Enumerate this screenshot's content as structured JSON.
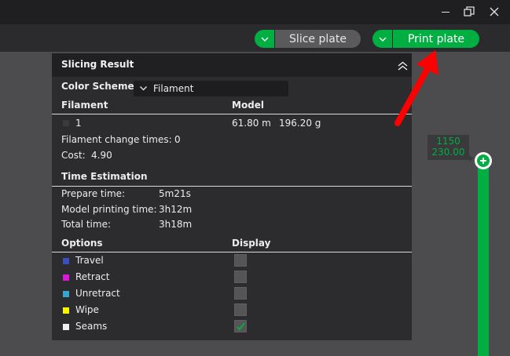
{
  "toolbar": {
    "slice_label": "Slice plate",
    "print_label": "Print plate"
  },
  "panel": {
    "title": "Slicing Result",
    "color_scheme_label": "Color Scheme",
    "color_scheme_value": "Filament",
    "filament_header": "Filament",
    "model_header": "Model",
    "filament_rows": [
      {
        "id": "1",
        "length": "61.80 m",
        "weight": "196.20 g",
        "color": "#3a3a3a"
      }
    ],
    "filament_change_label": "Filament change times:",
    "filament_change_value": "0",
    "cost_label": "Cost:",
    "cost_value": "4.90",
    "time_header": "Time Estimation",
    "times": [
      {
        "label": "Prepare time:",
        "value": "5m21s"
      },
      {
        "label": "Model printing time:",
        "value": "3h12m"
      },
      {
        "label": "Total time:",
        "value": "3h18m"
      }
    ],
    "options_header": "Options",
    "display_header": "Display",
    "options": [
      {
        "label": "Travel",
        "color": "#3a4fbd",
        "checked": false
      },
      {
        "label": "Retract",
        "color": "#d61ad6",
        "checked": false
      },
      {
        "label": "Unretract",
        "color": "#35a6cf",
        "checked": false
      },
      {
        "label": "Wipe",
        "color": "#f5f500",
        "checked": false
      },
      {
        "label": "Seams",
        "color": "#eeeeee",
        "checked": true
      }
    ]
  },
  "layer_slider": {
    "layer": "1150",
    "height": "230.00"
  },
  "colors": {
    "accent": "#00ae42",
    "arrow": "#ff0000"
  }
}
